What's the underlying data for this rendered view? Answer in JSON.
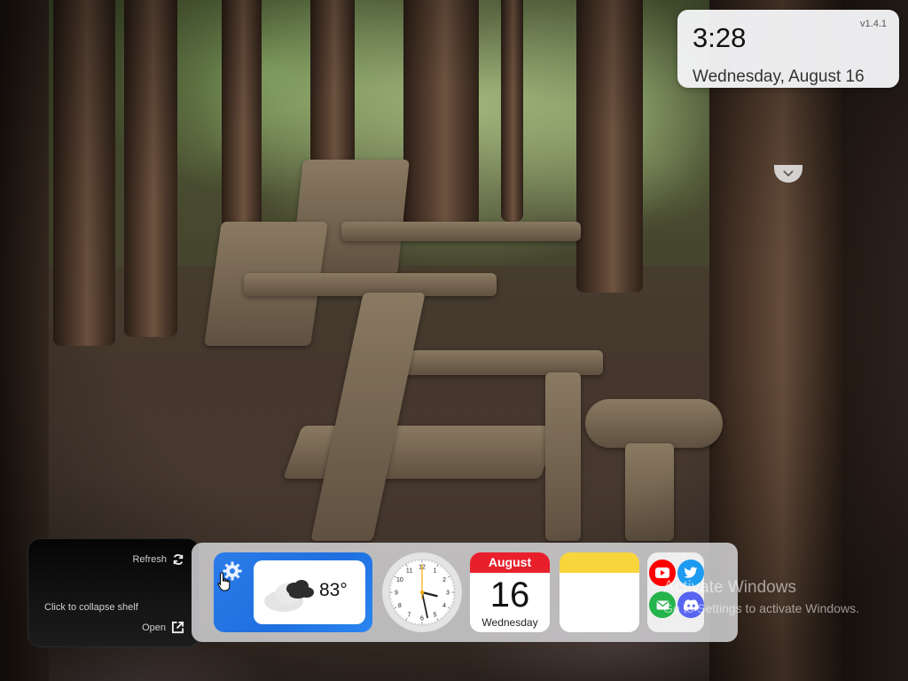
{
  "clock_widget": {
    "version": "v1.4.1",
    "time": "3:28",
    "date": "Wednesday, August 16"
  },
  "shelf_panel": {
    "refresh_label": "Refresh",
    "collapse_label": "Click to collapse shelf",
    "open_label": "Open"
  },
  "dock": {
    "weather": {
      "temperature": "83°",
      "icon": "cloud-icon",
      "settings_icon": "gear-icon"
    },
    "analog_clock": {
      "hour": 3,
      "minute": 28,
      "second": 0,
      "numbers": [
        "12",
        "1",
        "2",
        "3",
        "4",
        "5",
        "6",
        "7",
        "8",
        "9",
        "10",
        "11"
      ]
    },
    "calendar": {
      "month": "August",
      "day": "16",
      "weekday": "Wednesday"
    },
    "notes": {},
    "social": [
      {
        "name": "youtube-icon",
        "color": "#ff0000"
      },
      {
        "name": "twitter-icon",
        "color": "#1d9bf0"
      },
      {
        "name": "mail-icon",
        "color": "#25b34b"
      },
      {
        "name": "discord-icon",
        "color": "#5865f2"
      }
    ]
  },
  "watermark": {
    "title": "Activate Windows",
    "subtitle": "Go to Settings to activate Windows."
  },
  "colors": {
    "weather_blue": "#1f6fe0",
    "calendar_red": "#e8202c",
    "notes_yellow": "#f8d53b"
  }
}
